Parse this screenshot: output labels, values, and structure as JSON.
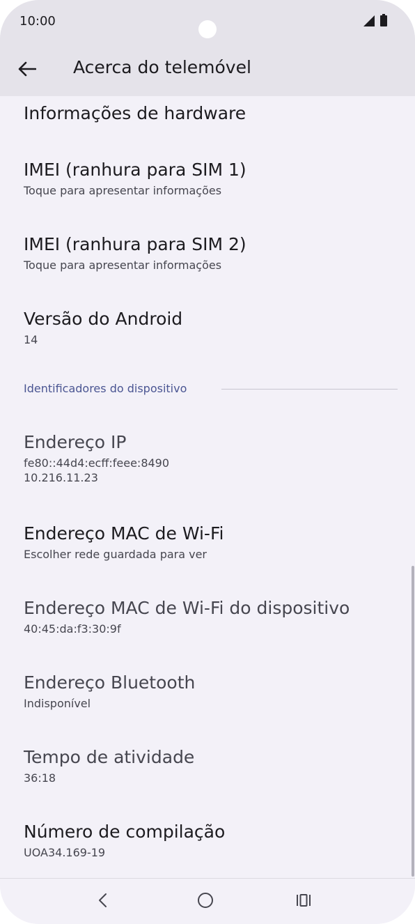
{
  "status_bar": {
    "time": "10:00"
  },
  "header": {
    "title": "Acerca do telemóvel",
    "back_icon": "arrow-back-icon"
  },
  "items": [
    {
      "title": "Informações de hardware",
      "subtitle": ""
    },
    {
      "title": "IMEI (ranhura para SIM 1)",
      "subtitle": "Toque para apresentar informações"
    },
    {
      "title": "IMEI (ranhura para SIM 2)",
      "subtitle": "Toque para apresentar informações"
    },
    {
      "title": "Versão do Android",
      "subtitle": "14"
    }
  ],
  "section": {
    "title": "Identificadores do dispositivo"
  },
  "identifiers": [
    {
      "title": "Endereço IP",
      "subtitle": "fe80::44d4:ecff:feee:8490",
      "subtitle2": "10.216.11.23"
    },
    {
      "title": "Endereço MAC de Wi-Fi",
      "subtitle": "Escolher rede guardada para ver"
    },
    {
      "title": "Endereço MAC de Wi-Fi do dispositivo",
      "subtitle": "40:45:da:f3:30:9f"
    },
    {
      "title": "Endereço Bluetooth",
      "subtitle": "Indisponível"
    },
    {
      "title": "Tempo de atividade",
      "subtitle": "36:18"
    },
    {
      "title": "Número de compilação",
      "subtitle": "UOA34.169-19"
    }
  ],
  "nav_bar": {
    "back_icon": "nav-back-icon",
    "home_icon": "nav-home-icon",
    "recents_icon": "nav-recents-icon"
  },
  "colors": {
    "background": "#f3f1f8",
    "header_background": "#e5e3ea",
    "section_accent": "#4a5592"
  }
}
